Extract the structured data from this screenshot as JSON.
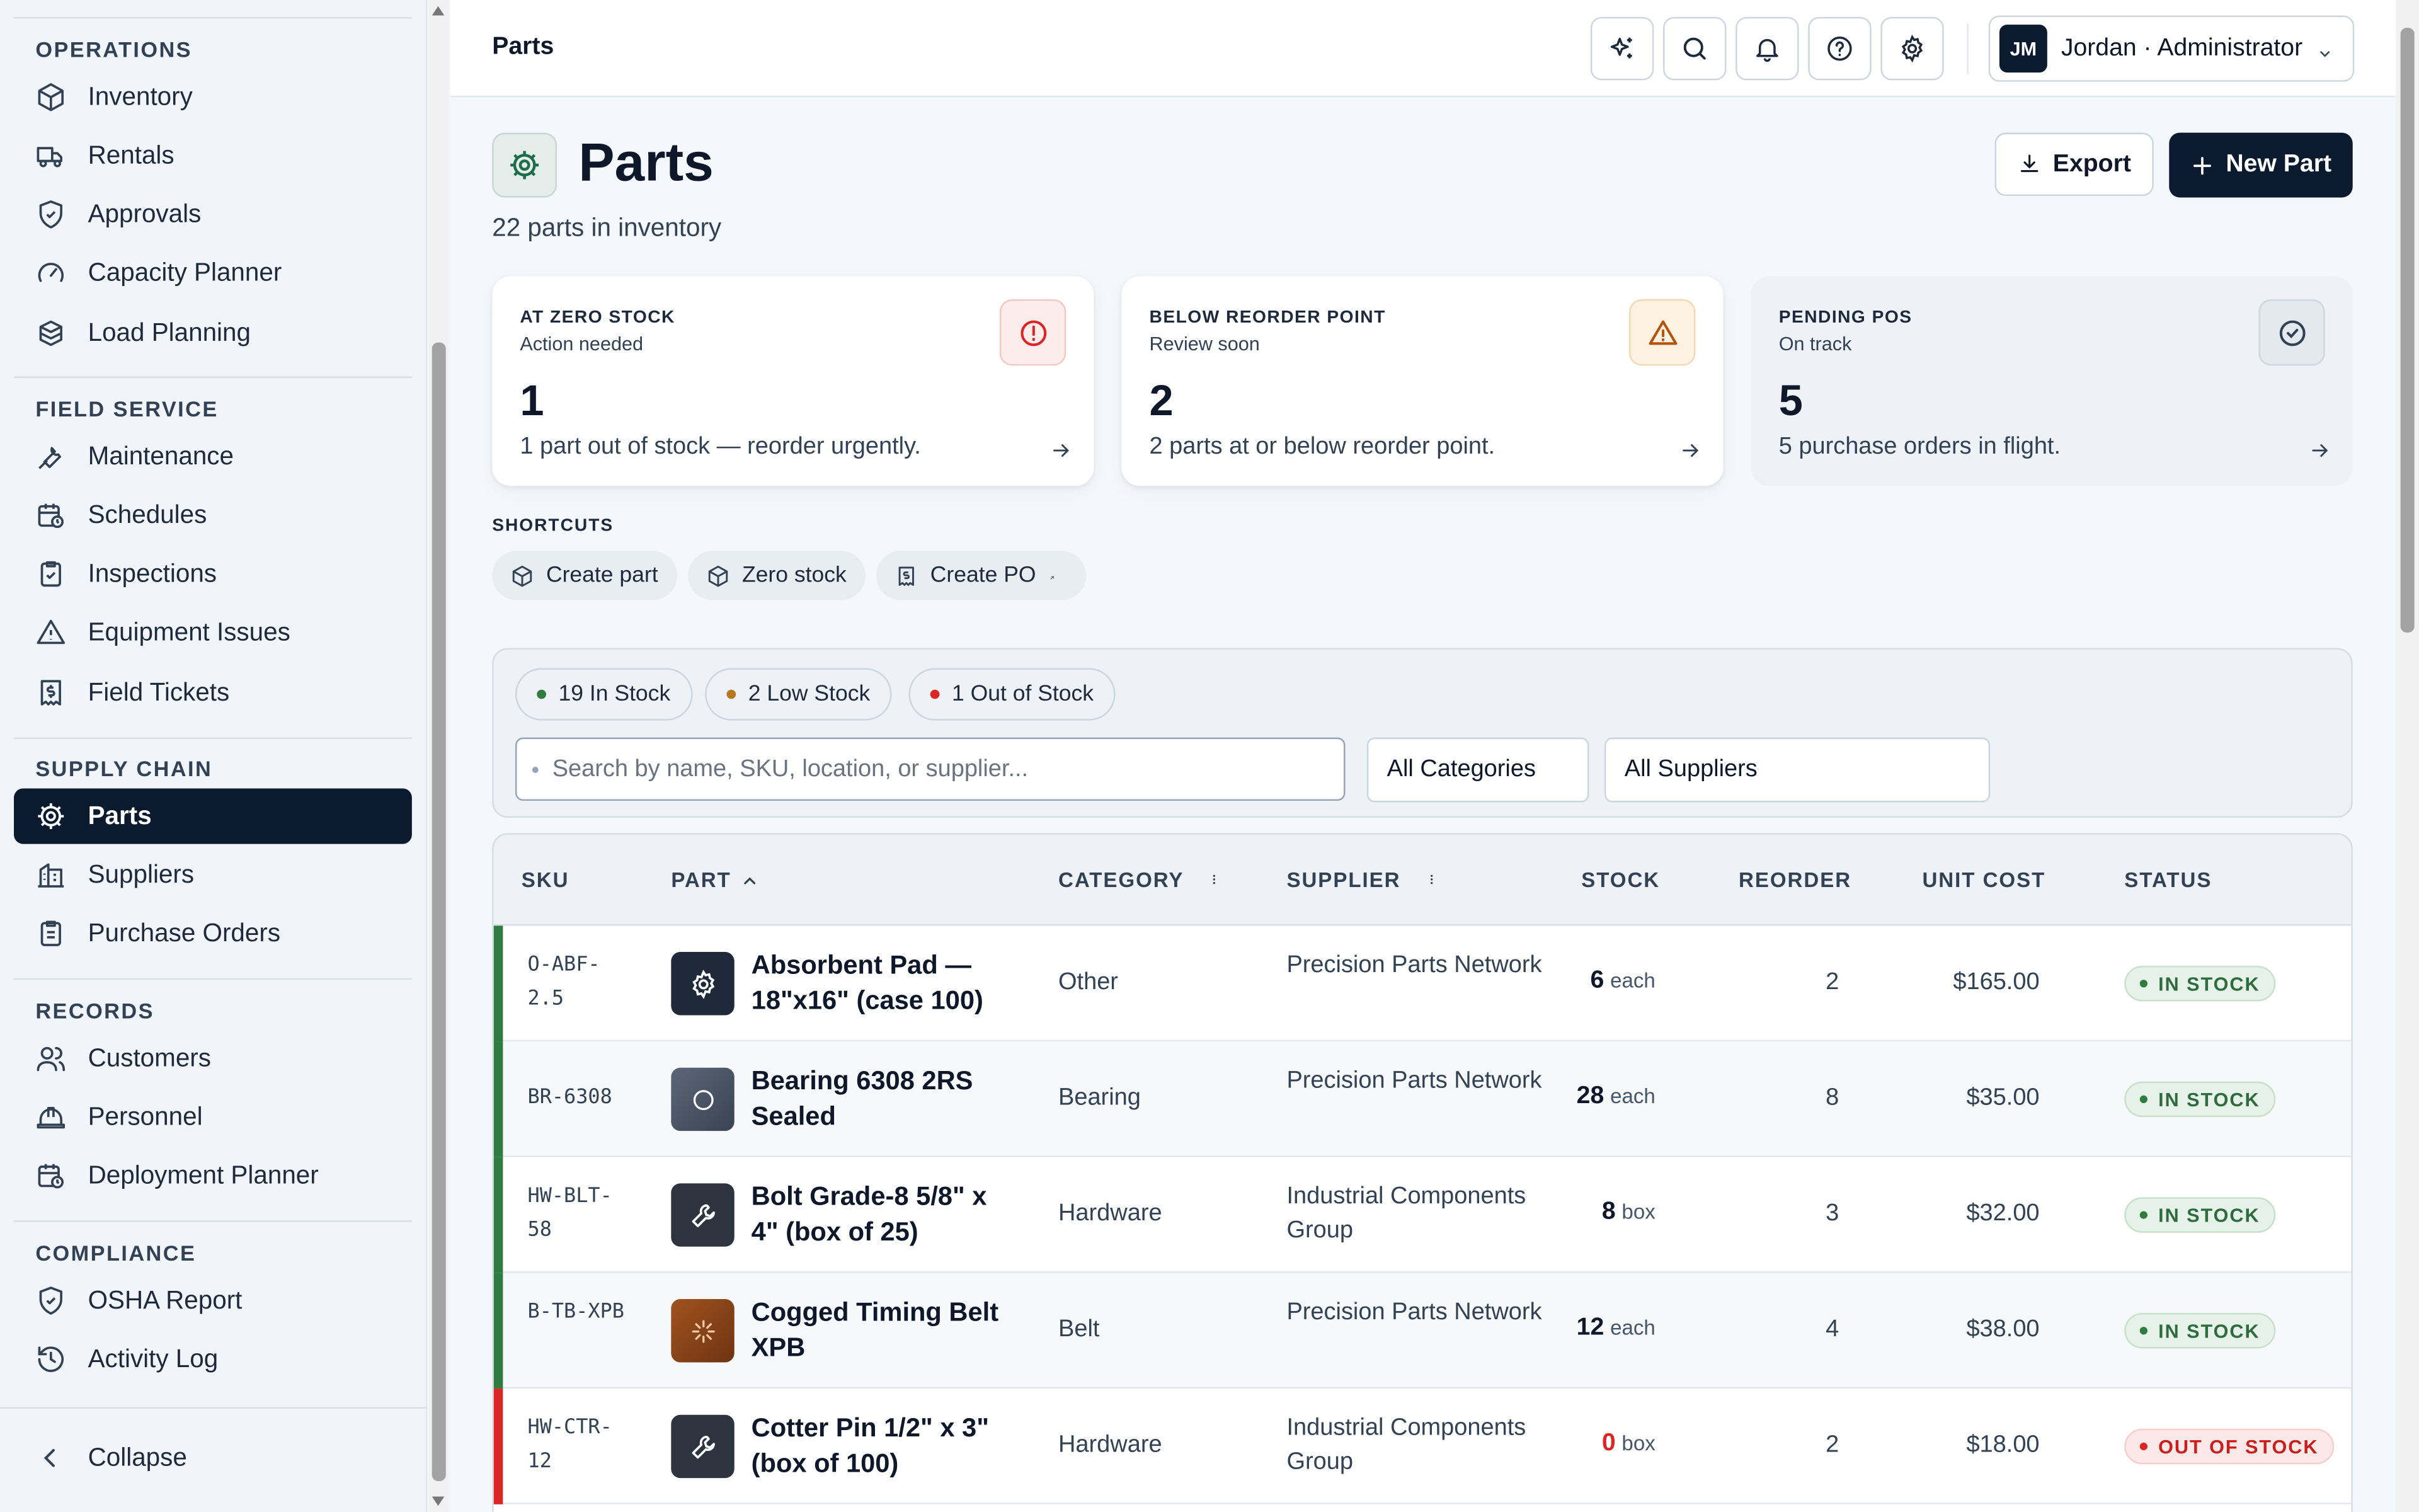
{
  "sidebar": {
    "sections": {
      "operations": "OPERATIONS",
      "field_service": "FIELD SERVICE",
      "supply_chain": "SUPPLY CHAIN",
      "records": "RECORDS",
      "compliance": "COMPLIANCE"
    },
    "items": {
      "inventory": "Inventory",
      "rentals": "Rentals",
      "approvals": "Approvals",
      "capacity_planner": "Capacity Planner",
      "load_planning": "Load Planning",
      "maintenance": "Maintenance",
      "schedules": "Schedules",
      "inspections": "Inspections",
      "equipment_issues": "Equipment Issues",
      "field_tickets": "Field Tickets",
      "parts": "Parts",
      "suppliers": "Suppliers",
      "purchase_orders": "Purchase Orders",
      "customers": "Customers",
      "personnel": "Personnel",
      "deployment_planner": "Deployment Planner",
      "osha_report": "OSHA Report",
      "activity_log": "Activity Log"
    },
    "active_item": "Parts",
    "collapse_label": "Collapse"
  },
  "header": {
    "breadcrumb": "Parts",
    "user_initials": "JM",
    "user_label": "Jordan · Administrator"
  },
  "page": {
    "title": "Parts",
    "subtitle": "22 parts in inventory",
    "export_label": "Export",
    "new_label": "New Part"
  },
  "kpis": [
    {
      "label": "AT ZERO STOCK",
      "sub": "Action needed",
      "value": "1",
      "desc": "1 part out of stock — reorder urgently.",
      "icon": "alert-circle-icon",
      "color": "#dc2626"
    },
    {
      "label": "BELOW REORDER POINT",
      "sub": "Review soon",
      "value": "2",
      "desc": "2 parts at or below reorder point.",
      "icon": "warning-icon",
      "color": "#b45309"
    },
    {
      "label": "PENDING POS",
      "sub": "On track",
      "value": "5",
      "desc": "5 purchase orders in flight.",
      "icon": "check-circle-icon",
      "color": "#334155"
    }
  ],
  "shortcuts": {
    "label": "SHORTCUTS",
    "items": [
      "Create part",
      "Zero stock",
      "Create PO"
    ]
  },
  "filters": {
    "pills": [
      "19 In Stock",
      "2 Low Stock",
      "1 Out of Stock"
    ],
    "pill_colors": [
      "#2e7d3e",
      "#b7791f",
      "#dc2626"
    ],
    "search_placeholder": "Search by name, SKU, location, or supplier...",
    "category_value": "All Categories",
    "supplier_value": "All Suppliers"
  },
  "table": {
    "columns": [
      "SKU",
      "PART",
      "CATEGORY",
      "SUPPLIER",
      "STOCK",
      "REORDER",
      "UNIT COST",
      "STATUS"
    ],
    "rows": [
      {
        "sku": "O-ABF-2.5",
        "part": "Absorbent Pad — 18\"x16\" (case 100)",
        "category": "Other",
        "supplier": "Precision Parts Network",
        "stock": "6",
        "unit": "each",
        "reorder": "2",
        "cost": "$165.00",
        "status": "IN STOCK",
        "thumb_color": "#1e2a3a",
        "icon": "gear-icon"
      },
      {
        "sku": "BR-6308",
        "part": "Bearing 6308 2RS Sealed",
        "category": "Bearing",
        "supplier": "Precision Parts Network",
        "stock": "28",
        "unit": "each",
        "reorder": "8",
        "cost": "$35.00",
        "status": "IN STOCK",
        "thumb_color": "#4a5568",
        "icon": "circle-icon"
      },
      {
        "sku": "HW-BLT-58",
        "part": "Bolt Grade-8 5/8\" x 4\" (box of 25)",
        "category": "Hardware",
        "supplier": "Industrial Components Group",
        "stock": "8",
        "unit": "box",
        "reorder": "3",
        "cost": "$32.00",
        "status": "IN STOCK",
        "thumb_color": "#2d3440",
        "icon": "wrench-icon"
      },
      {
        "sku": "B-TB-XPB",
        "part": "Cogged Timing Belt XPB",
        "category": "Belt",
        "supplier": "Precision Parts Network",
        "stock": "12",
        "unit": "each",
        "reorder": "4",
        "cost": "$38.00",
        "status": "IN STOCK",
        "thumb_color": "#8a4a1f",
        "icon": "spinner-icon"
      },
      {
        "sku": "HW-CTR-12",
        "part": "Cotter Pin 1/2\" x 3\" (box of 100)",
        "category": "Hardware",
        "supplier": "Industrial Components Group",
        "stock": "0",
        "unit": "box",
        "reorder": "2",
        "cost": "$18.00",
        "status": "OUT OF STOCK",
        "thumb_color": "#2d3440",
        "icon": "wrench-icon"
      }
    ]
  }
}
